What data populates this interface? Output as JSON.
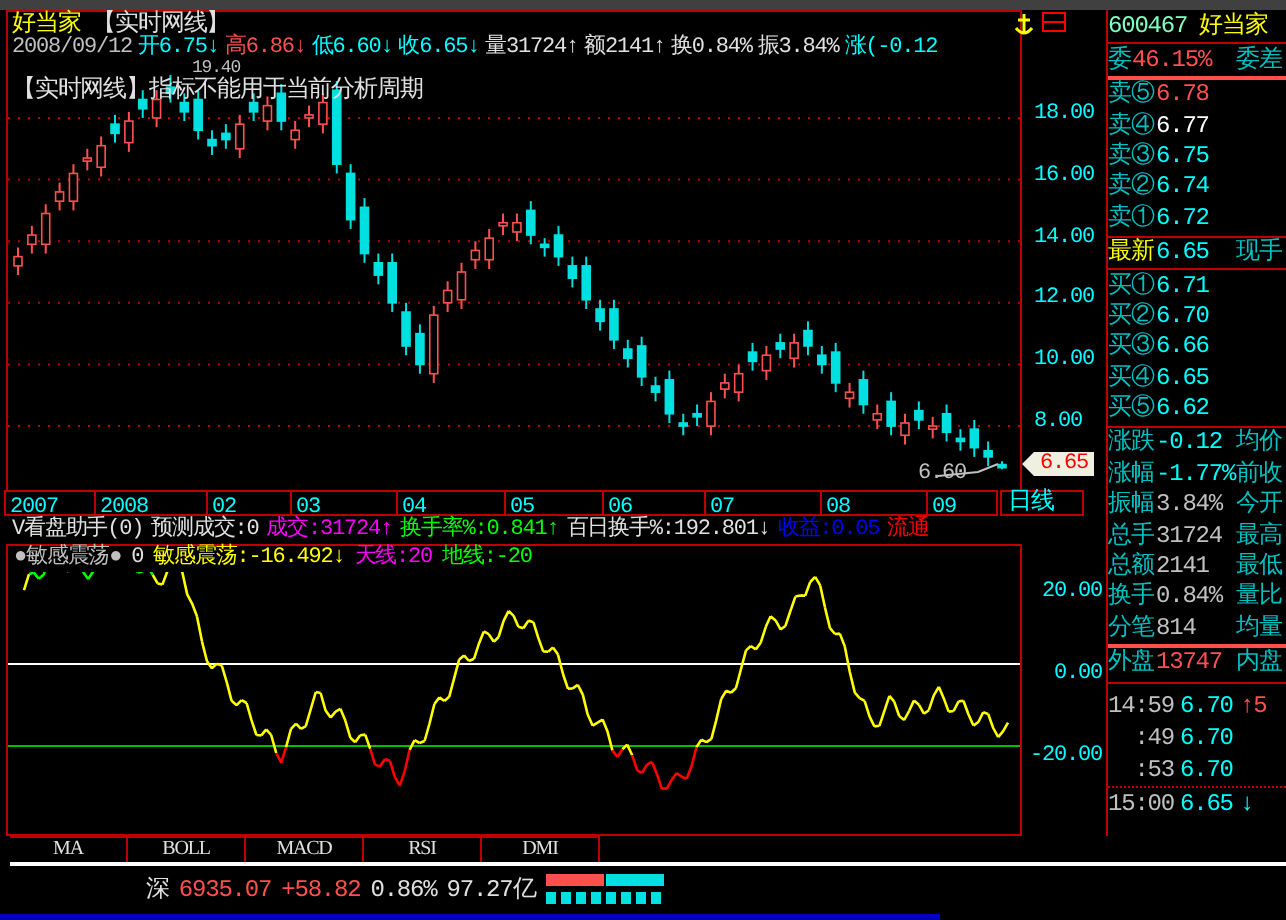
{
  "header": {
    "name": "好当家",
    "mode": "【实时网线】"
  },
  "quote_line": [
    {
      "text": "2008/09/12",
      "color": "#c0c0c0"
    },
    {
      "text": "开6.75↓",
      "color": "#00ffff"
    },
    {
      "text": "高6.86↓",
      "color": "#ff5050"
    },
    {
      "text": "低6.60↓",
      "color": "#00ffff"
    },
    {
      "text": "收6.65↓",
      "color": "#00ffff"
    },
    {
      "text": "量31724↑",
      "color": "#e0e0e0"
    },
    {
      "text": "额2141↑",
      "color": "#e0e0e0"
    },
    {
      "text": "换0.84%",
      "color": "#e0e0e0"
    },
    {
      "text": "振3.84%",
      "color": "#e0e0e0"
    },
    {
      "text": "涨(-0.12",
      "color": "#00ffff"
    }
  ],
  "notice": "【实时网线】指标不能用于当前分析周期",
  "peak_label": "19.40",
  "low_label": "6.60",
  "price_chart": {
    "chart_data": {
      "type": "candlestick",
      "grid": true,
      "ylim": [
        5.86,
        21.44
      ],
      "yticks": [
        {
          "value": 18,
          "label": "18.00"
        },
        {
          "value": 16,
          "label": "16.00"
        },
        {
          "value": 14,
          "label": "14.00"
        },
        {
          "value": 12,
          "label": "12.00"
        },
        {
          "value": 10,
          "label": "10.00"
        },
        {
          "value": 8,
          "label": "8.00"
        }
      ],
      "ohlc": [
        [
          13.2,
          13.8,
          12.9,
          13.5
        ],
        [
          13.9,
          14.5,
          13.6,
          14.2
        ],
        [
          13.9,
          15.2,
          13.6,
          14.9
        ],
        [
          15.3,
          15.9,
          15.0,
          15.6
        ],
        [
          15.3,
          16.5,
          15.0,
          16.2
        ],
        [
          16.6,
          17.0,
          16.3,
          16.7
        ],
        [
          16.4,
          17.4,
          16.1,
          17.1
        ],
        [
          17.8,
          18.1,
          17.2,
          17.5
        ],
        [
          17.2,
          18.2,
          16.9,
          17.9
        ],
        [
          18.6,
          18.9,
          18.0,
          18.3
        ],
        [
          18.0,
          18.9,
          17.7,
          18.6
        ],
        [
          19.0,
          19.4,
          18.5,
          18.8
        ],
        [
          18.5,
          18.8,
          17.9,
          18.2
        ],
        [
          18.6,
          18.9,
          17.3,
          17.6
        ],
        [
          17.3,
          17.6,
          16.8,
          17.1
        ],
        [
          17.5,
          17.8,
          17.0,
          17.3
        ],
        [
          17.0,
          18.1,
          16.7,
          17.8
        ],
        [
          18.5,
          18.8,
          17.9,
          18.2
        ],
        [
          17.9,
          18.7,
          17.6,
          18.4
        ],
        [
          18.8,
          19.1,
          17.6,
          17.9
        ],
        [
          17.3,
          17.9,
          17.0,
          17.6
        ],
        [
          18.0,
          18.4,
          17.7,
          18.1
        ],
        [
          17.8,
          18.8,
          17.5,
          18.5
        ],
        [
          18.9,
          19.2,
          16.2,
          16.5
        ],
        [
          16.2,
          16.5,
          14.4,
          14.7
        ],
        [
          15.1,
          15.4,
          13.3,
          13.6
        ],
        [
          13.3,
          13.6,
          12.6,
          12.9
        ],
        [
          13.3,
          13.6,
          11.7,
          12.0
        ],
        [
          11.7,
          12.0,
          10.3,
          10.6
        ],
        [
          11.0,
          11.3,
          9.7,
          10.0
        ],
        [
          9.7,
          11.9,
          9.4,
          11.6
        ],
        [
          12.0,
          12.7,
          11.7,
          12.4
        ],
        [
          12.1,
          13.3,
          11.8,
          13.0
        ],
        [
          13.4,
          14.0,
          13.1,
          13.7
        ],
        [
          13.4,
          14.4,
          13.1,
          14.1
        ],
        [
          14.5,
          14.9,
          14.2,
          14.6
        ],
        [
          14.3,
          14.9,
          14.0,
          14.6
        ],
        [
          15.0,
          15.3,
          13.9,
          14.2
        ],
        [
          13.9,
          14.1,
          13.5,
          13.8
        ],
        [
          14.2,
          14.5,
          13.2,
          13.5
        ],
        [
          13.2,
          13.5,
          12.5,
          12.8
        ],
        [
          13.2,
          13.5,
          11.8,
          12.1
        ],
        [
          11.8,
          12.1,
          11.1,
          11.4
        ],
        [
          11.8,
          12.1,
          10.5,
          10.8
        ],
        [
          10.5,
          10.8,
          9.9,
          10.2
        ],
        [
          10.6,
          10.9,
          9.3,
          9.6
        ],
        [
          9.3,
          9.6,
          8.8,
          9.1
        ],
        [
          9.5,
          9.8,
          8.1,
          8.4
        ],
        [
          8.1,
          8.4,
          7.7,
          8.0
        ],
        [
          8.4,
          8.7,
          8.0,
          8.3
        ],
        [
          8.0,
          9.1,
          7.7,
          8.8
        ],
        [
          9.2,
          9.7,
          8.9,
          9.4
        ],
        [
          9.1,
          10.0,
          8.8,
          9.7
        ],
        [
          10.4,
          10.7,
          9.8,
          10.1
        ],
        [
          9.8,
          10.6,
          9.5,
          10.3
        ],
        [
          10.7,
          11.0,
          10.2,
          10.5
        ],
        [
          10.2,
          11.0,
          9.9,
          10.7
        ],
        [
          11.1,
          11.4,
          10.3,
          10.6
        ],
        [
          10.3,
          10.6,
          9.7,
          10.0
        ],
        [
          10.4,
          10.7,
          9.1,
          9.4
        ],
        [
          8.9,
          9.4,
          8.6,
          9.1
        ],
        [
          9.5,
          9.8,
          8.4,
          8.7
        ],
        [
          8.2,
          8.7,
          7.9,
          8.4
        ],
        [
          8.8,
          9.1,
          7.7,
          8.0
        ],
        [
          7.7,
          8.4,
          7.4,
          8.1
        ],
        [
          8.5,
          8.8,
          7.9,
          8.2
        ],
        [
          7.9,
          8.3,
          7.6,
          8.0
        ],
        [
          8.4,
          8.7,
          7.5,
          7.8
        ],
        [
          7.6,
          7.9,
          7.2,
          7.5
        ],
        [
          7.9,
          8.2,
          7.0,
          7.3
        ],
        [
          7.2,
          7.5,
          6.7,
          7.0
        ],
        [
          6.75,
          6.86,
          6.6,
          6.65
        ]
      ]
    }
  },
  "price_tag": "6.65",
  "date_axis": [
    "2007",
    "2008",
    "02",
    "03",
    "04",
    "05",
    "06",
    "07",
    "08",
    "09"
  ],
  "period_button": "日线",
  "indicator_line": [
    {
      "text": "V看盘助手(0)",
      "color": "#e0e0e0"
    },
    {
      "text": "预测成交:0",
      "color": "#e0e0e0"
    },
    {
      "text": "成交:31724↑",
      "color": "#ff00ff"
    },
    {
      "text": "换手率%:0.841↑",
      "color": "#00ff00"
    },
    {
      "text": "百日换手%:192.801↓",
      "color": "#e0e0e0"
    },
    {
      "text": "收益:0.05",
      "color": "#0000ff"
    },
    {
      "text": "流通",
      "color": "#ff0000"
    }
  ],
  "oscillator_legend": [
    {
      "text": "●敏感震荡●",
      "color": "#c0c0c0"
    },
    {
      "text": "0",
      "color": "#e0e0e0"
    },
    {
      "text": "敏感震荡:-16.492↓",
      "color": "#ffff00"
    },
    {
      "text": "天线:20",
      "color": "#ff00ff"
    },
    {
      "text": "地线:-20",
      "color": "#00ff00"
    }
  ],
  "oscillator_axis": [
    "20.00",
    "0.00",
    "-20.00"
  ],
  "indicator_tabs": [
    "MA",
    "BOLL",
    "MACD",
    "RSI",
    "DMI"
  ],
  "status_bar": {
    "market": "深",
    "index": "6935.07",
    "change": "+58.82",
    "percent": "0.86%",
    "amount": "97.27亿"
  },
  "quote_panel": {
    "code": "600467",
    "name": "好当家",
    "ratio": {
      "label": "委",
      "value": "46.15%",
      "extra": "委差"
    },
    "asks": [
      {
        "label": "卖⑤",
        "price": "6.78",
        "color": "#ff5050"
      },
      {
        "label": "卖④",
        "price": "6.77",
        "color": "#ffffff"
      },
      {
        "label": "卖③",
        "price": "6.75",
        "color": "#00ffff"
      },
      {
        "label": "卖②",
        "price": "6.74",
        "color": "#00ffff"
      },
      {
        "label": "卖①",
        "price": "6.72",
        "color": "#00ffff"
      }
    ],
    "latest": {
      "label": "最新",
      "price": "6.65",
      "extra": "现手"
    },
    "bids": [
      {
        "label": "买①",
        "price": "6.71",
        "color": "#00ffff"
      },
      {
        "label": "买②",
        "price": "6.70",
        "color": "#00ffff"
      },
      {
        "label": "买③",
        "price": "6.66",
        "color": "#00ffff"
      },
      {
        "label": "买④",
        "price": "6.65",
        "color": "#00ffff"
      },
      {
        "label": "买⑤",
        "price": "6.62",
        "color": "#00ffff"
      }
    ],
    "stats": [
      {
        "label": "涨跌",
        "value": "-0.12",
        "extra": "均价",
        "color": "#00ffff"
      },
      {
        "label": "涨幅",
        "value": "-1.77%",
        "extra": "前收",
        "color": "#00ffff"
      },
      {
        "label": "振幅",
        "value": "3.84%",
        "extra": "今开",
        "color": "#c0c0c0"
      },
      {
        "label": "总手",
        "value": "31724",
        "extra": "最高",
        "color": "#c0c0c0"
      },
      {
        "label": "总额",
        "value": "2141",
        "extra": "最低",
        "color": "#c0c0c0"
      },
      {
        "label": "换手",
        "value": "0.84%",
        "extra": "量比",
        "color": "#c0c0c0"
      },
      {
        "label": "分笔",
        "value": "814",
        "extra": "均量",
        "color": "#c0c0c0"
      }
    ],
    "outer": {
      "label": "外盘",
      "value": "13747",
      "extra": "内盘"
    },
    "ticks": [
      {
        "time": "14:59",
        "price": "6.70",
        "volume": "↑5"
      },
      {
        "time": ":49",
        "price": "6.70"
      },
      {
        "time": ":53",
        "price": "6.70"
      },
      {
        "time": "15:00",
        "price": "6.65",
        "volume": "↓"
      }
    ]
  }
}
